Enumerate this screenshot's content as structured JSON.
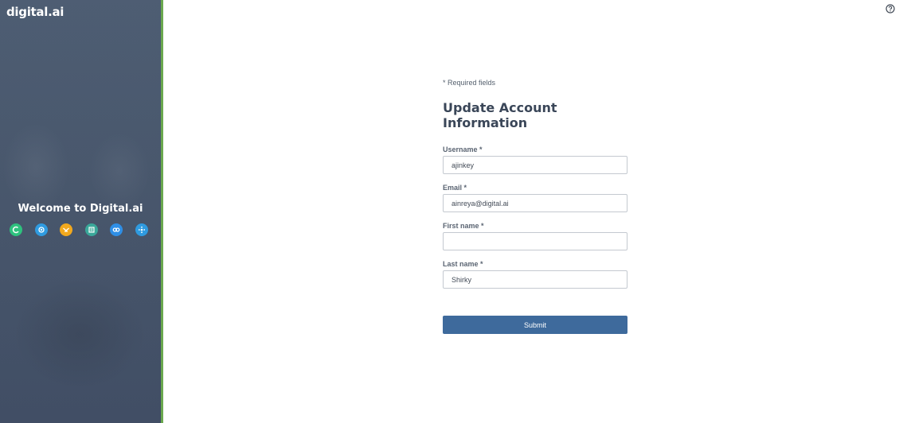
{
  "brand": {
    "logo_text": "digital.ai",
    "welcome": "Welcome to Digital.ai",
    "accent": "#6aa84f",
    "panel_color": "#48576d",
    "product_icons": [
      {
        "name": "agility-icon",
        "color": "#2ec27e"
      },
      {
        "name": "release-icon",
        "color": "#2f9be0"
      },
      {
        "name": "deploy-icon",
        "color": "#f2a91e"
      },
      {
        "name": "continuous-testing-icon",
        "color": "#3aa89a"
      },
      {
        "name": "intelligence-icon",
        "color": "#2f8fe6"
      },
      {
        "name": "app-protection-icon",
        "color": "#2f9be0"
      }
    ]
  },
  "header": {
    "help_icon": "question-circle-icon"
  },
  "form": {
    "required_note": "* Required fields",
    "title": "Update Account Information",
    "fields": {
      "username": {
        "label": "Username *",
        "value": "ajinkey"
      },
      "email": {
        "label": "Email *",
        "value": "ainreya@digital.ai"
      },
      "first_name": {
        "label": "First name *",
        "value": ""
      },
      "last_name": {
        "label": "Last name *",
        "value": "Shirky"
      }
    },
    "submit_label": "Submit",
    "button_color": "#3e6a9c"
  }
}
